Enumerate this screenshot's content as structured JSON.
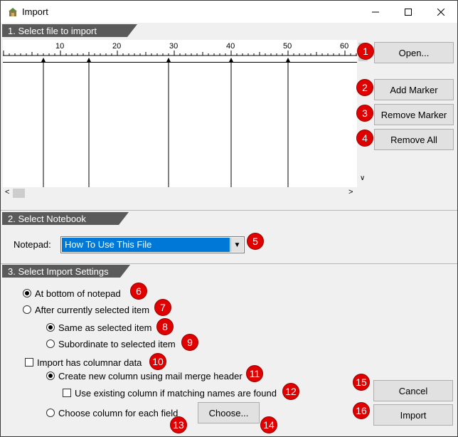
{
  "window": {
    "title": "Import"
  },
  "sections": {
    "file": "1. Select file to import",
    "notebook": "2. Select Notebook",
    "settings": "3. Select Import Settings"
  },
  "ruler": {
    "ticks": [
      "10",
      "20",
      "30",
      "40",
      "50",
      "60"
    ],
    "markers_at_columns": [
      7,
      15,
      29,
      40,
      50
    ]
  },
  "buttons": {
    "open": "Open...",
    "add_marker": "Add Marker",
    "remove_marker": "Remove Marker",
    "remove_all": "Remove All",
    "cancel": "Cancel",
    "import": "Import",
    "choose": "Choose..."
  },
  "notepad": {
    "label": "Notepad:",
    "selected": "How To Use This File"
  },
  "settings": {
    "at_bottom": "At bottom of notepad",
    "after_selected": "After currently selected item",
    "same_as": "Same as selected item",
    "subordinate": "Subordinate to selected item",
    "columnar": "Import has columnar data",
    "create_column": "Create new column using mail merge header",
    "use_existing": "Use existing column if matching names are found",
    "choose_column": "Choose column for each field"
  },
  "badges": [
    "1",
    "2",
    "3",
    "4",
    "5",
    "6",
    "7",
    "8",
    "9",
    "10",
    "11",
    "12",
    "13",
    "14",
    "15",
    "16"
  ],
  "colors": {
    "badge": "#e00000",
    "selection": "#0078d7",
    "section_header": "#5a5a5a"
  }
}
